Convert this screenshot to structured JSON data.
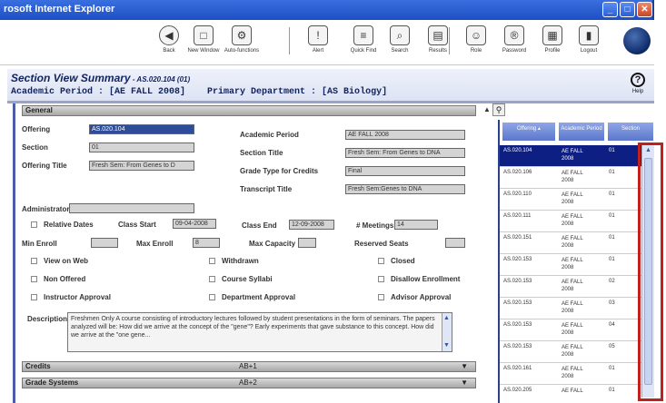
{
  "window": {
    "title": "rosoft Internet Explorer",
    "controls": [
      "minimize-button",
      "maximize-button",
      "close-button"
    ]
  },
  "toolbar": {
    "items": [
      {
        "label": "Back",
        "icon": "back-icon",
        "glyph": "◀"
      },
      {
        "label": "New Window",
        "icon": "new-window-icon",
        "glyph": "□"
      },
      {
        "label": "Auto-functions",
        "icon": "auto-functions-icon",
        "glyph": "⚙"
      },
      {
        "label": "Alert",
        "icon": "alert-icon",
        "glyph": "!"
      },
      {
        "label": "Quick Find",
        "icon": "quick-find-icon",
        "glyph": "≡"
      },
      {
        "label": "Search",
        "icon": "search-icon",
        "glyph": "⌕"
      },
      {
        "label": "Results",
        "icon": "results-icon",
        "glyph": "▤"
      },
      {
        "label": "Role",
        "icon": "role-icon",
        "glyph": "☺"
      },
      {
        "label": "Password",
        "icon": "password-icon",
        "glyph": "®"
      },
      {
        "label": "Profile",
        "icon": "profile-icon",
        "glyph": "▦"
      },
      {
        "label": "Logout",
        "icon": "logout-icon",
        "glyph": "▮"
      }
    ]
  },
  "header": {
    "title": "Section View Summary",
    "title_code": " - AS.020.104 (01)",
    "subtitle": "Academic Period : [AE FALL 2008]    Primary Department : [AS Biology]",
    "help_label": "Help"
  },
  "general": {
    "section_label": "General",
    "offering": {
      "label": "Offering",
      "value": "AS.020.104"
    },
    "section": {
      "label": "Section",
      "value": "01"
    },
    "offering_title": {
      "label": "Offering Title",
      "value": "Fresh Sem: From Genes to D"
    },
    "academic_period": {
      "label": "Academic Period",
      "value": "AE FALL 2008"
    },
    "section_title": {
      "label": "Section Title",
      "value": "Fresh Sem: From Genes to DNA"
    },
    "grade_type": {
      "label": "Grade Type for Credits",
      "value": "Final"
    },
    "transcript_title": {
      "label": "Transcript Title",
      "value": "Fresh Sem:Genes to DNA"
    },
    "administrator": {
      "label": "Administrator",
      "value": ""
    },
    "relative_dates": {
      "label": "Relative Dates"
    },
    "class_start": {
      "label": "Class Start",
      "value": "09-04-2008"
    },
    "class_end": {
      "label": "Class End",
      "value": "12-09-2008"
    },
    "meetings": {
      "label": "# Meetings",
      "value": "14"
    },
    "min_enroll": {
      "label": "Min Enroll",
      "value": ""
    },
    "max_enroll": {
      "label": "Max Enroll",
      "value": "8"
    },
    "max_capacity": {
      "label": "Max Capacity",
      "value": ""
    },
    "reserved_seats": {
      "label": "Reserved Seats",
      "value": ""
    },
    "checkboxes": [
      "View on Web",
      "Withdrawn",
      "Closed",
      "Non Offered",
      "Course Syllabi",
      "Disallow Enrollment",
      "Instructor Approval",
      "Department Approval",
      "Advisor Approval"
    ],
    "description": {
      "label": "Description",
      "value": "Freshmen Only A course consisting of introductory lectures followed by student presentations in the form of seminars. The papers analyzed will be: How did we arrive at the concept of the \"gene\"? Early experiments that gave substance to this concept. How did we arrive at the \"one gene..."
    }
  },
  "collapsed_sections": [
    {
      "label": "Credits",
      "value": "AB+1"
    },
    {
      "label": "Grade Systems",
      "value": "AB+2"
    }
  ],
  "grid": {
    "columns": [
      "Offering ▴",
      "Academic Period",
      "Section"
    ],
    "rows": [
      {
        "offering": "AS.020.104",
        "period": "AE FALL 2008",
        "section": "01",
        "selected": true
      },
      {
        "offering": "AS.020.106",
        "period": "AE FALL 2008",
        "section": "01"
      },
      {
        "offering": "AS.020.110",
        "period": "AE FALL 2008",
        "section": "01"
      },
      {
        "offering": "AS.020.111",
        "period": "AE FALL 2008",
        "section": "01"
      },
      {
        "offering": "AS.020.151",
        "period": "AE FALL 2008",
        "section": "01"
      },
      {
        "offering": "AS.020.153",
        "period": "AE FALL 2008",
        "section": "01"
      },
      {
        "offering": "AS.020.153",
        "period": "AE FALL 2008",
        "section": "02"
      },
      {
        "offering": "AS.020.153",
        "period": "AE FALL 2008",
        "section": "03"
      },
      {
        "offering": "AS.020.153",
        "period": "AE FALL 2008",
        "section": "04"
      },
      {
        "offering": "AS.020.153",
        "period": "AE FALL 2008",
        "section": "05"
      },
      {
        "offering": "AS.020.161",
        "period": "AE FALL 2008",
        "section": "01"
      },
      {
        "offering": "AS.020.205",
        "period": "AE FALL",
        "section": "01"
      }
    ]
  },
  "colors": {
    "titlebar": "#1d4fc2",
    "selection": "#0e1f84",
    "highlight": "#c21f1f",
    "grid_header": "#5b77cc"
  }
}
